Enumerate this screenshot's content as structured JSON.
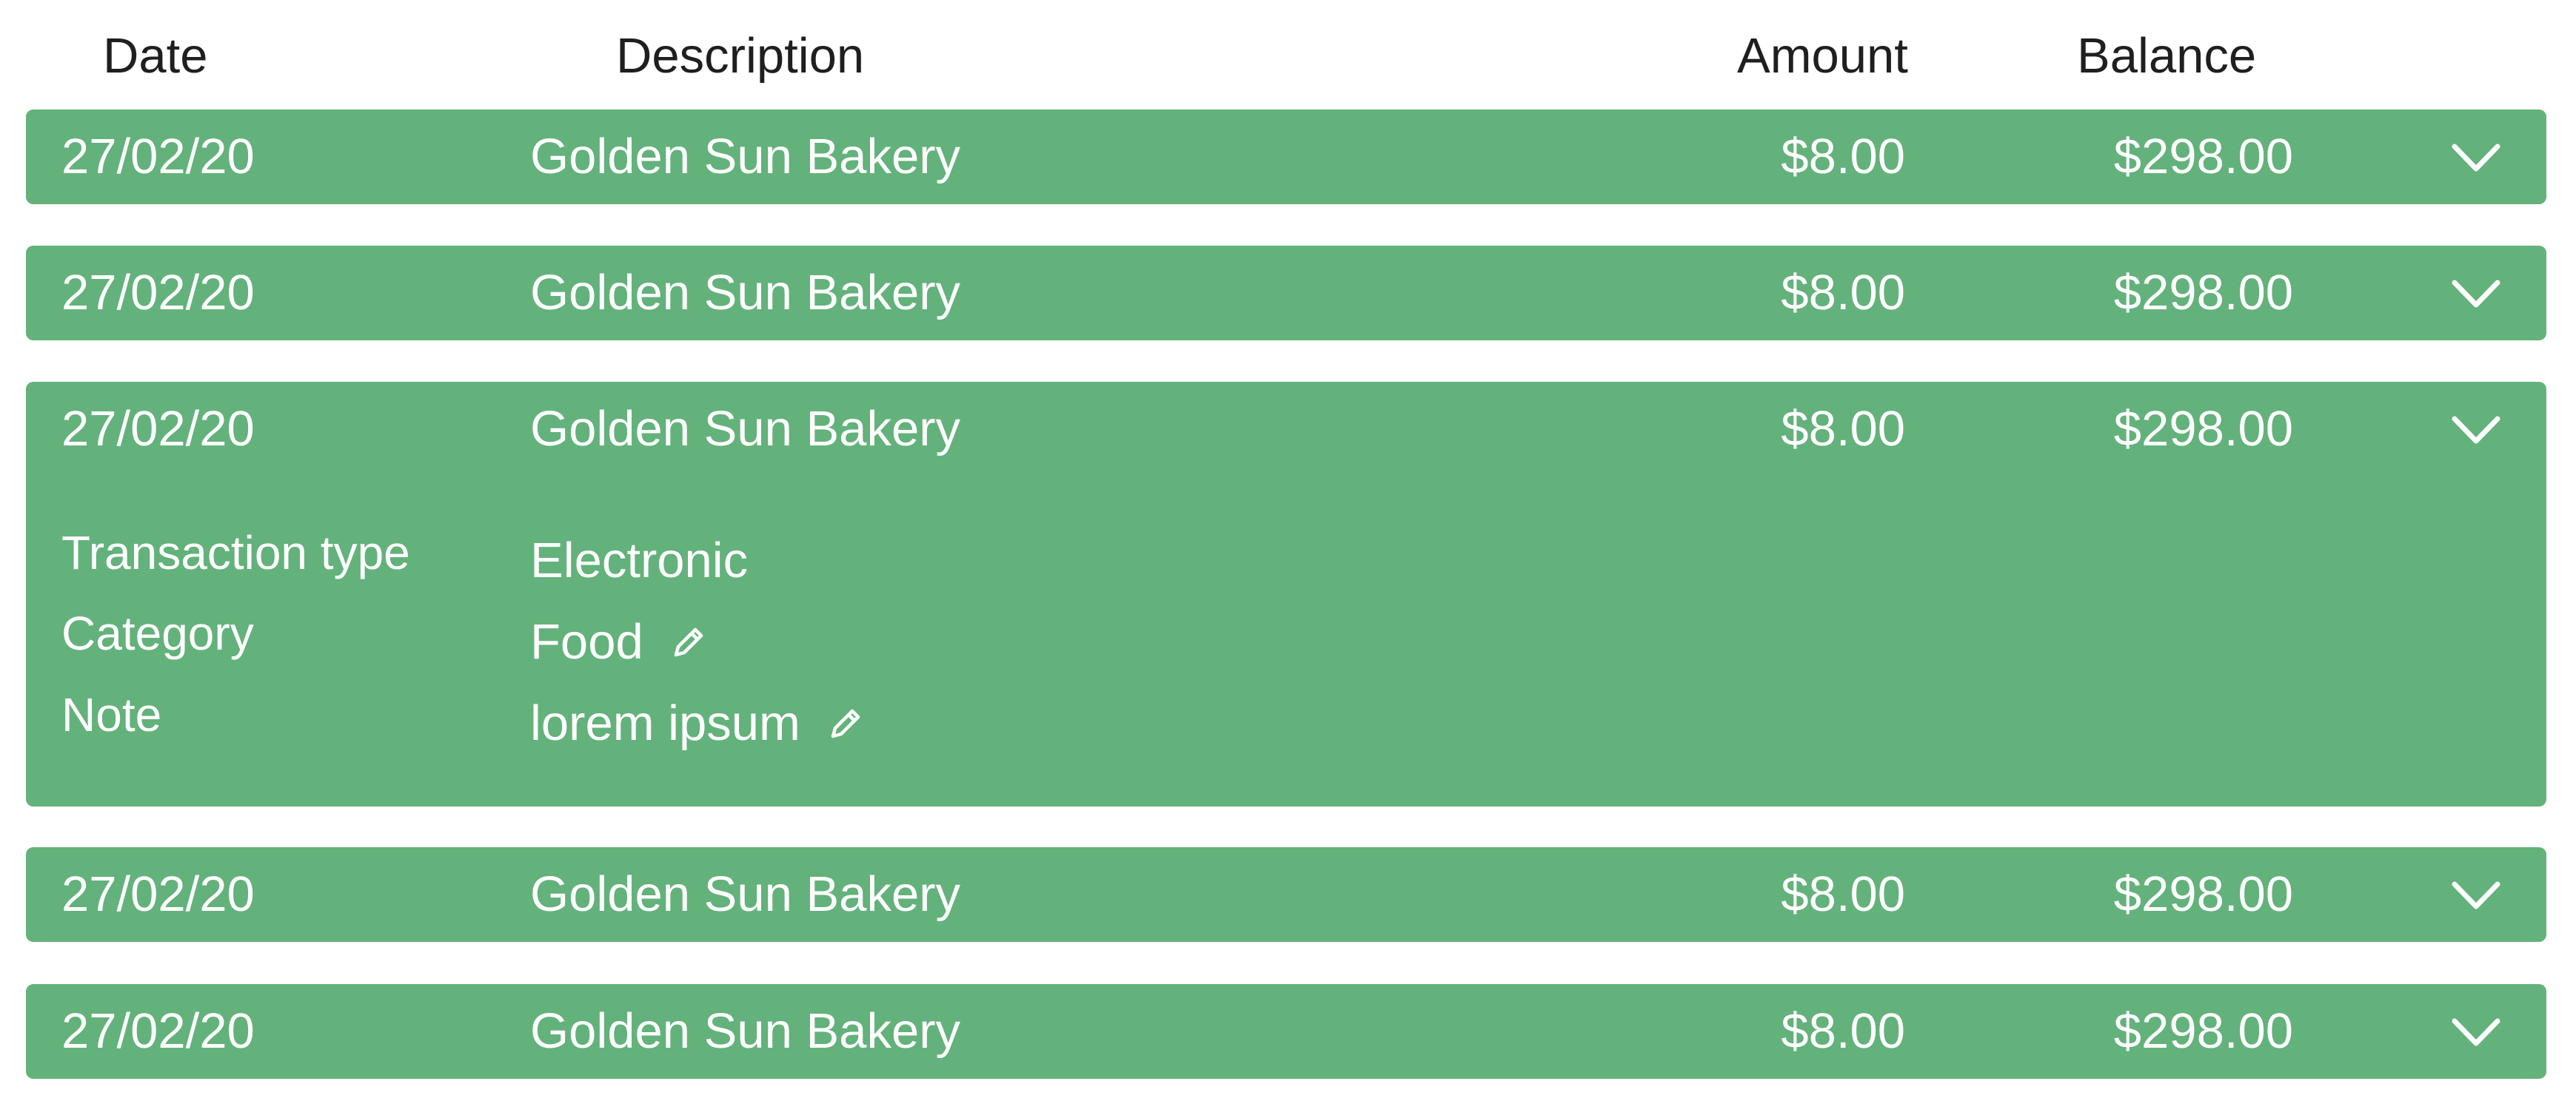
{
  "header": {
    "date": "Date",
    "description": "Description",
    "amount": "Amount",
    "balance": "Balance"
  },
  "rows": [
    {
      "date": "27/02/20",
      "description": "Golden Sun Bakery",
      "amount": "$8.00",
      "balance": "$298.00"
    },
    {
      "date": "27/02/20",
      "description": "Golden Sun Bakery",
      "amount": "$8.00",
      "balance": "$298.00"
    },
    {
      "date": "27/02/20",
      "description": "Golden Sun Bakery",
      "amount": "$8.00",
      "balance": "$298.00",
      "expanded": true,
      "details": {
        "transaction_type_label": "Transaction type",
        "transaction_type_value": "Electronic",
        "category_label": "Category",
        "category_value": "Food",
        "note_label": "Note",
        "note_value": "lorem ipsum"
      }
    },
    {
      "date": "27/02/20",
      "description": "Golden Sun Bakery",
      "amount": "$8.00",
      "balance": "$298.00"
    },
    {
      "date": "27/02/20",
      "description": "Golden Sun Bakery",
      "amount": "$8.00",
      "balance": "$298.00"
    }
  ],
  "icons": {
    "expand": "chevron-down-icon",
    "edit": "pencil-icon"
  },
  "colors": {
    "row_background": "#63b27b",
    "row_text": "#ffffff",
    "header_text": "#1f1f1f"
  }
}
